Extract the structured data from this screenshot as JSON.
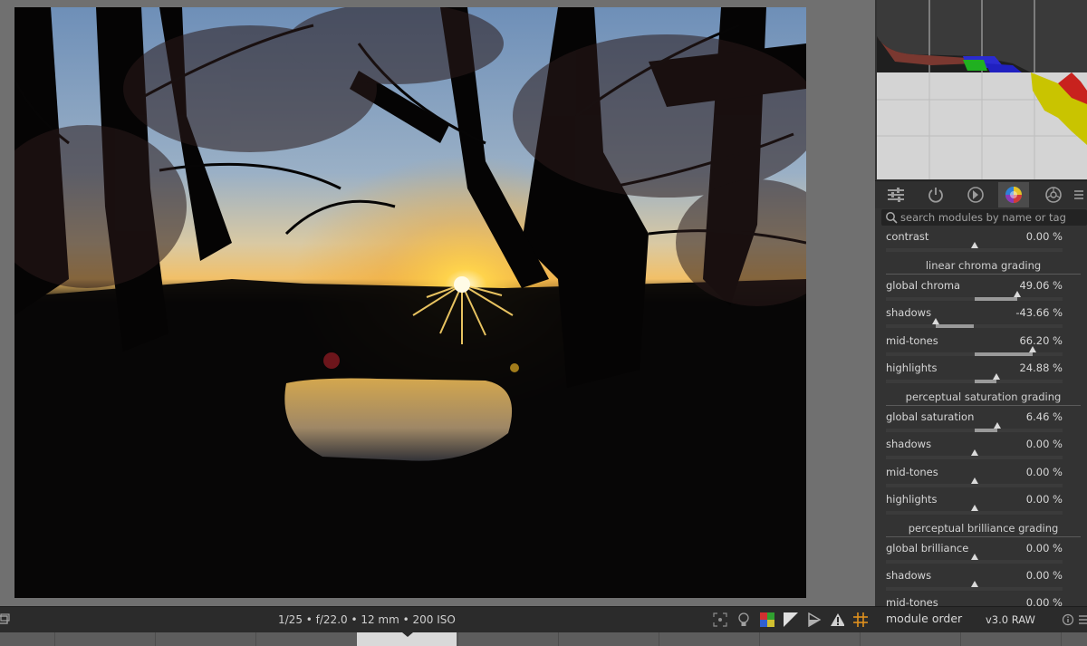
{
  "bottom": {
    "exif": "1/25 • f/22.0 • 12 mm • 200 ISO",
    "module_order_label": "module order",
    "module_order_value": "v3.0 RAW"
  },
  "search": {
    "placeholder": "search modules by name or tag"
  },
  "tabs": [
    {
      "name": "quick-access-panel-icon",
      "active": false
    },
    {
      "name": "active-modules-icon",
      "active": false
    },
    {
      "name": "base-modules-icon",
      "active": false
    },
    {
      "name": "color-modules-icon",
      "active": true
    },
    {
      "name": "effect-modules-icon",
      "active": false
    },
    {
      "name": "menu-icon",
      "active": false
    }
  ],
  "module": {
    "contrast": {
      "label": "contrast",
      "value": "0.00 %",
      "fraction": 0.5
    },
    "linear_chroma": {
      "title": "linear chroma grading",
      "global": {
        "label": "global chroma",
        "value": "49.06 %",
        "fraction": 0.745
      },
      "shadows": {
        "label": "shadows",
        "value": "-43.66 %",
        "fraction": 0.282
      },
      "midtones": {
        "label": "mid-tones",
        "value": "66.20 %",
        "fraction": 0.831
      },
      "highlights": {
        "label": "highlights",
        "value": "24.88 %",
        "fraction": 0.624
      }
    },
    "perceptual_saturation": {
      "title": "perceptual saturation grading",
      "global": {
        "label": "global saturation",
        "value": "6.46 %",
        "fraction": 0.632
      },
      "shadows": {
        "label": "shadows",
        "value": "0.00 %",
        "fraction": 0.5
      },
      "midtones": {
        "label": "mid-tones",
        "value": "0.00 %",
        "fraction": 0.5
      },
      "highlights": {
        "label": "highlights",
        "value": "0.00 %",
        "fraction": 0.5
      }
    },
    "perceptual_brilliance": {
      "title": "perceptual brilliance grading",
      "global": {
        "label": "global brilliance",
        "value": "0.00 %",
        "fraction": 0.5
      },
      "shadows": {
        "label": "shadows",
        "value": "0.00 %",
        "fraction": 0.5
      },
      "midtones": {
        "label": "mid-tones",
        "value": "0.00 %",
        "fraction": 0.5
      }
    }
  },
  "colors": {
    "panel": "#333333",
    "accent_yellow": "#c9c400",
    "accent_red": "#c8221e",
    "guide_orange": "#e0901e"
  }
}
